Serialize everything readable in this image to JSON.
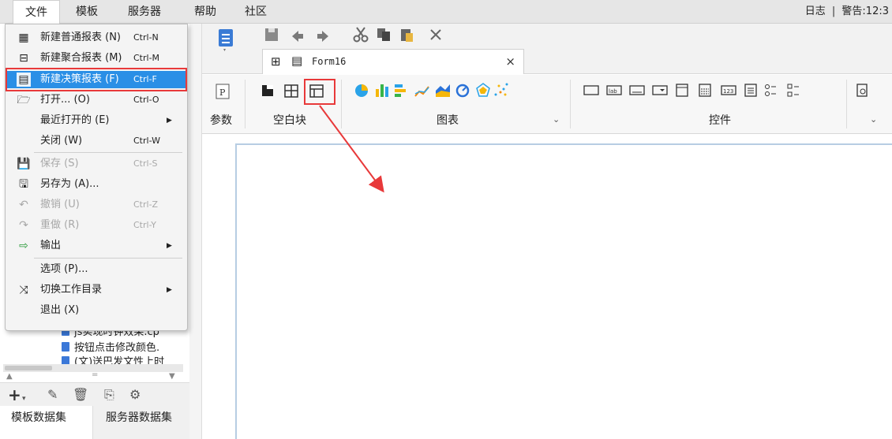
{
  "menubar": {
    "file": "文件",
    "template": "模板",
    "server": "服务器",
    "help": "帮助",
    "community": "社区",
    "log": "日志",
    "separator": "|",
    "warning": "警告:12:3"
  },
  "file_menu": {
    "items": [
      {
        "label": "新建普通报表 (N)",
        "shortcut": "Ctrl-N"
      },
      {
        "label": "新建聚合报表 (M)",
        "shortcut": "Ctrl-M"
      },
      {
        "label": "新建决策报表 (F)",
        "shortcut": "Ctrl-F"
      },
      {
        "label": "打开... (O)",
        "shortcut": "Ctrl-O"
      },
      {
        "label": "最近打开的 (E)",
        "shortcut": ""
      },
      {
        "label": "关闭 (W)",
        "shortcut": "Ctrl-W"
      },
      {
        "label": "保存 (S)",
        "shortcut": "Ctrl-S"
      },
      {
        "label": "另存为 (A)...",
        "shortcut": ""
      },
      {
        "label": "撤销 (U)",
        "shortcut": "Ctrl-Z"
      },
      {
        "label": "重做 (R)",
        "shortcut": "Ctrl-Y"
      },
      {
        "label": "输出",
        "shortcut": ""
      },
      {
        "label": "选项 (P)...",
        "shortcut": ""
      },
      {
        "label": "切换工作目录",
        "shortcut": ""
      },
      {
        "label": "退出 (X)",
        "shortcut": ""
      }
    ]
  },
  "tree": {
    "rows": [
      "js实现时钟效果.cp",
      "按钮点击修改颜色.",
      "(文)送巴发文性上时"
    ]
  },
  "left_tabs": {
    "template_ds": "模板数据集",
    "server_ds": "服务器数据集"
  },
  "editor_tab": {
    "label": "Form16",
    "close": "×"
  },
  "widget_groups": {
    "params": "参数",
    "blank": "空白块",
    "chart": "图表",
    "controls": "控件"
  },
  "colors": {
    "highlight": "#e8393a",
    "selected_menu": "#2a8fe6",
    "design_border": "#b7cde3"
  }
}
